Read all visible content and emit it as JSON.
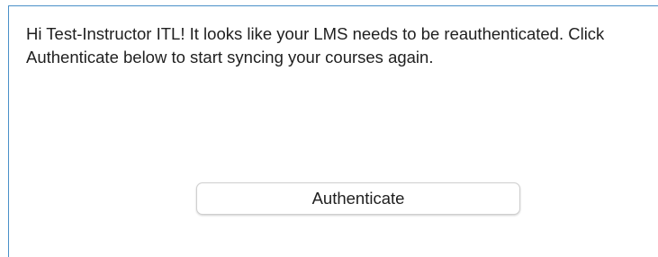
{
  "dialog": {
    "message": "Hi Test-Instructor ITL! It looks like your LMS needs to be reauthenticated. Click Authenticate below to start syncing your courses again.",
    "authenticate_label": "Authenticate"
  },
  "colors": {
    "border_accent": "#4a90c8",
    "text": "#1f1f1f",
    "button_border": "#cfcfcf"
  }
}
